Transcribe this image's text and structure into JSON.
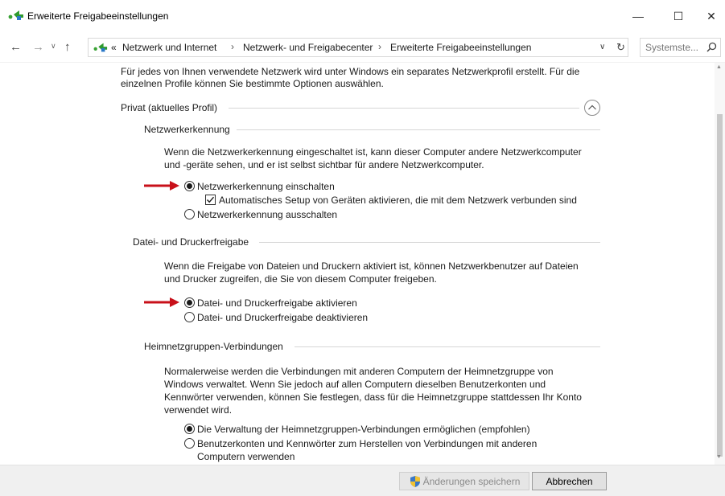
{
  "window": {
    "title": "Erweiterte Freigabeeinstellungen",
    "minimize": "—",
    "maximize": "☐",
    "close": "✕"
  },
  "nav": {
    "back": "←",
    "forward": "→",
    "recent": "∨",
    "up": "↑",
    "breadcrumb_prefix": "«",
    "breadcrumb": [
      "Netzwerk und Internet",
      "Netzwerk- und Freigabecenter",
      "Erweiterte Freigabeeinstellungen"
    ],
    "separator": "›",
    "dropdown": "∨",
    "refresh": "↻"
  },
  "search": {
    "placeholder": "Systemste..."
  },
  "content": {
    "intro_line1": "Für jedes von Ihnen verwendete Netzwerk wird unter Windows ein separates Netzwerkprofil erstellt. Für die",
    "intro_line2": "einzelnen Profile können Sie bestimmte Optionen auswählen.",
    "profile_title": "Privat (aktuelles Profil)",
    "sections": {
      "network_discovery": {
        "title": "Netzwerkerkennung",
        "desc_line1": "Wenn die Netzwerkerkennung eingeschaltet ist, kann dieser Computer andere Netzwerkcomputer",
        "desc_line2": "und -geräte sehen, und er ist selbst sichtbar für andere Netzwerkcomputer.",
        "option_on": "Netzwerkerkennung einschalten",
        "option_auto_setup": "Automatisches Setup von Geräten aktivieren, die mit dem Netzwerk verbunden sind",
        "option_off": "Netzwerkerkennung ausschalten",
        "selected": "on",
        "auto_setup_checked": true
      },
      "file_printer": {
        "title": "Datei- und Druckerfreigabe",
        "desc_line1": "Wenn die Freigabe von Dateien und Druckern aktiviert ist, können Netzwerkbenutzer auf Dateien",
        "desc_line2": "und Drucker zugreifen, die Sie von diesem Computer freigeben.",
        "option_on": "Datei- und Druckerfreigabe aktivieren",
        "option_off": "Datei- und Druckerfreigabe deaktivieren",
        "selected": "on"
      },
      "homegroup": {
        "title": "Heimnetzgruppen-Verbindungen",
        "desc_line1": "Normalerweise werden die Verbindungen mit anderen Computern der Heimnetzgruppe von",
        "desc_line2": "Windows verwaltet. Wenn Sie jedoch auf allen Computern dieselben Benutzerkonten und",
        "desc_line3": "Kennwörter verwenden, können Sie festlegen, dass für die Heimnetzgruppe stattdessen Ihr Konto",
        "desc_line4": "verwendet wird.",
        "option_windows": "Die Verwaltung der Heimnetzgruppen-Verbindungen ermöglichen (empfohlen)",
        "option_accounts_line1": "Benutzerkonten und Kennwörter zum Herstellen von Verbindungen mit anderen",
        "option_accounts_line2": "Computern verwenden",
        "selected": "windows"
      }
    }
  },
  "footer": {
    "save_label": "Änderungen speichern",
    "cancel_label": "Abbrechen"
  },
  "colors": {
    "annotation_arrow": "#c8101a",
    "network_icon_green": "#3aa335",
    "network_icon_blue": "#2a78c8",
    "shield_blue": "#3a78c6",
    "shield_yellow": "#f2c230"
  }
}
